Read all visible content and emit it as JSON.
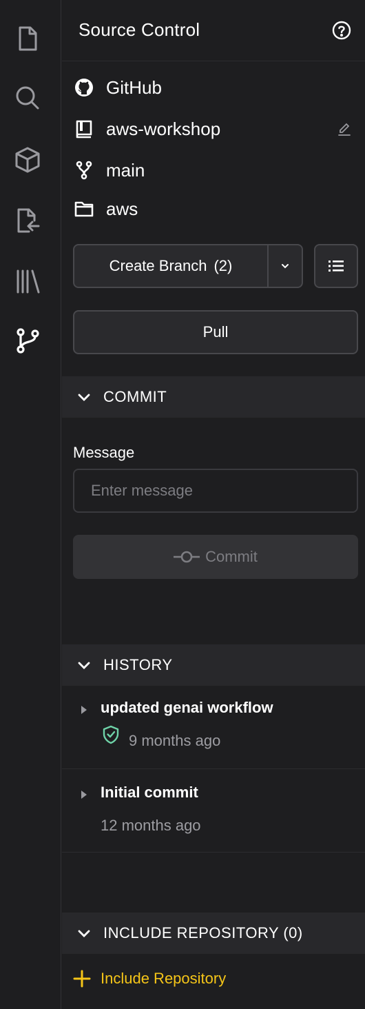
{
  "activity_bar": {
    "items": [
      {
        "icon": "file-icon"
      },
      {
        "icon": "search-icon"
      },
      {
        "icon": "cube-icon"
      },
      {
        "icon": "file-import-icon"
      },
      {
        "icon": "library-icon"
      },
      {
        "icon": "git-branch-icon",
        "active": true
      }
    ]
  },
  "panel": {
    "title": "Source Control",
    "help_icon": "help-circle-icon"
  },
  "repo": {
    "provider": "GitHub",
    "name": "aws-workshop",
    "branch": "main",
    "folder": "aws"
  },
  "actions": {
    "create_branch_label": "Create Branch",
    "create_branch_count": "(2)",
    "pull_label": "Pull"
  },
  "commit_section": {
    "header": "COMMIT",
    "message_label": "Message",
    "message_placeholder": "Enter message",
    "message_value": "",
    "commit_label": "Commit"
  },
  "history_section": {
    "header": "HISTORY",
    "items": [
      {
        "title": "updated genai workflow",
        "time": "9 months ago",
        "verified": true
      },
      {
        "title": "Initial commit",
        "time": "12 months ago",
        "verified": false
      }
    ]
  },
  "include_section": {
    "header": "INCLUDE REPOSITORY (0)",
    "link_label": "Include Repository"
  },
  "colors": {
    "background": "#1e1e20",
    "section_header": "#28282b",
    "accent_yellow": "#f5c518",
    "verified_green": "#6fd3a8",
    "muted_text": "#9d9da2"
  }
}
